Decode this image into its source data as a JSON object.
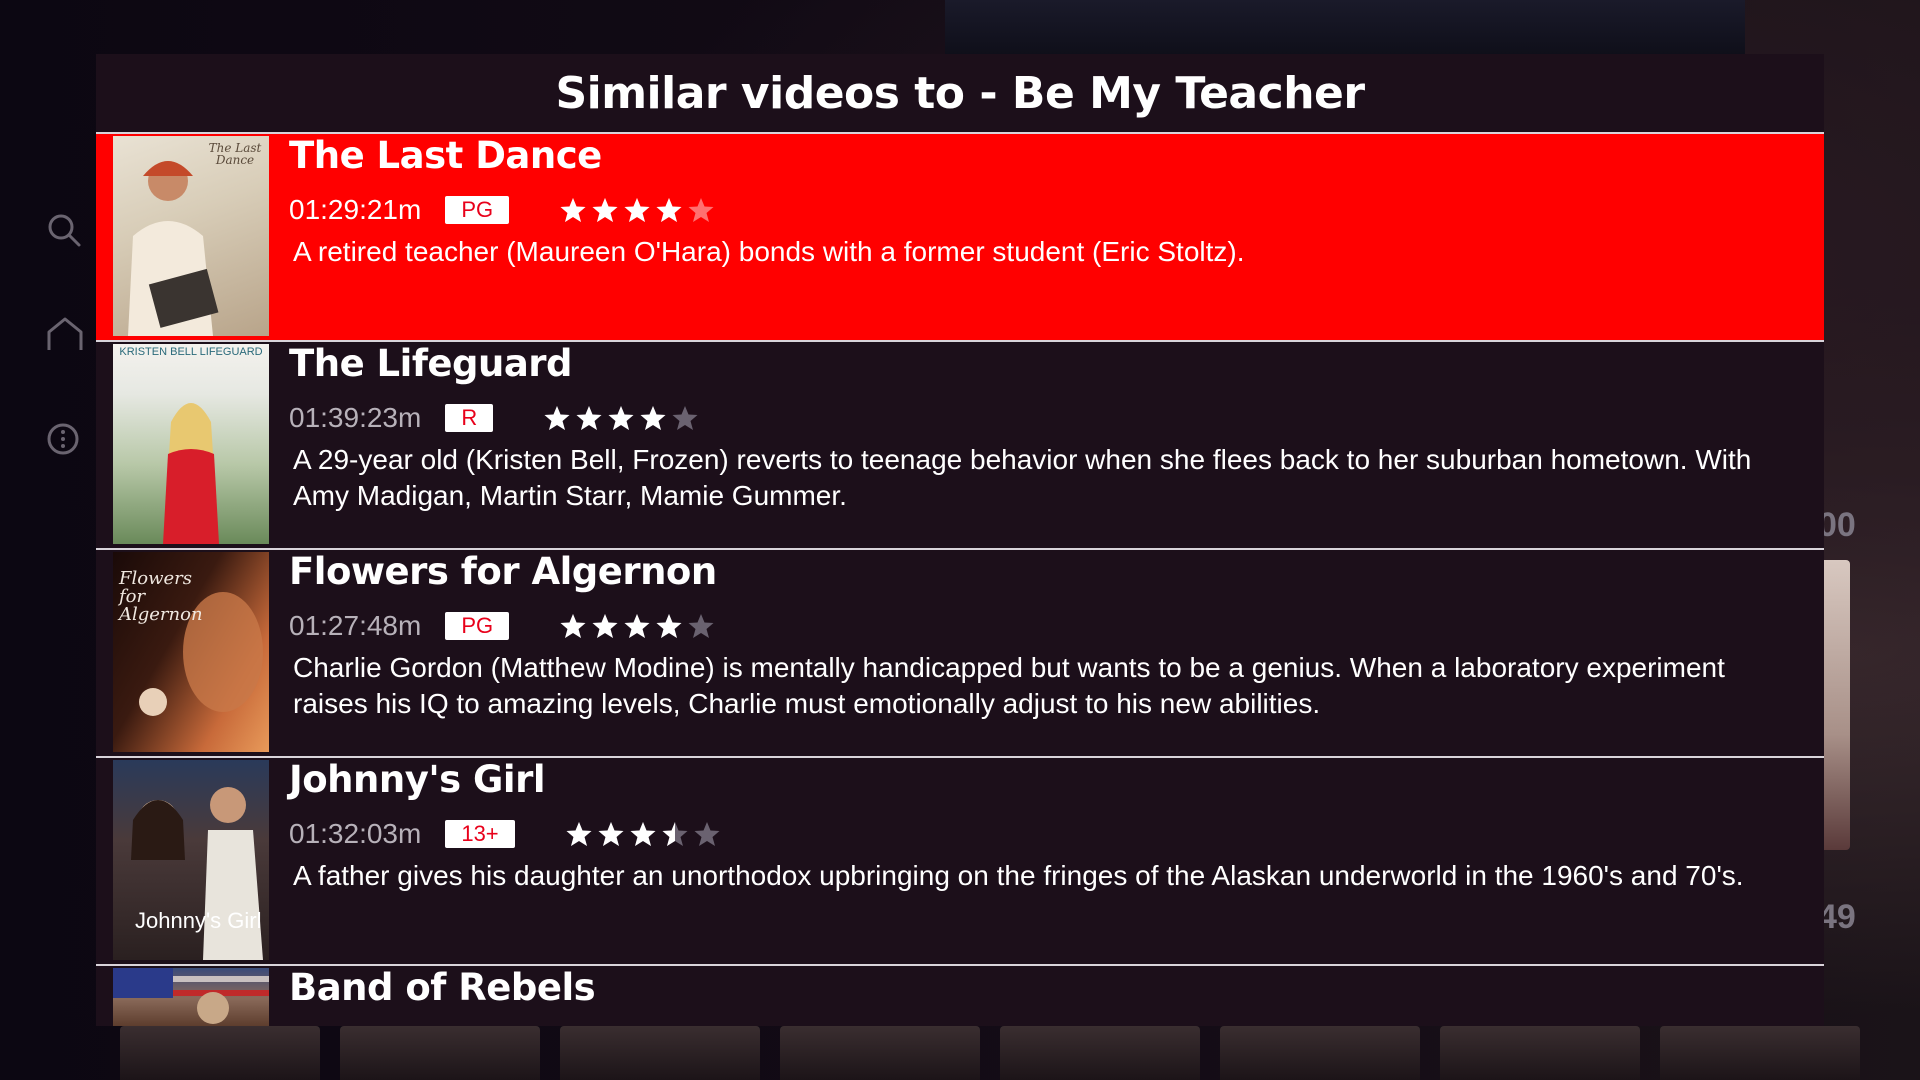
{
  "panel": {
    "title": "Similar videos to - Be My Teacher"
  },
  "background": {
    "right_text_1": "00",
    "right_text_2": "49"
  },
  "sidebar": {
    "icons": [
      "search-icon",
      "home-icon",
      "info-icon"
    ]
  },
  "videos": [
    {
      "title": "The Last Dance",
      "duration": "01:29:21m",
      "rating": "PG",
      "stars": 4,
      "description": "A retired teacher (Maureen O'Hara) bonds with a former student (Eric Stoltz).",
      "poster_text": "The Last Dance",
      "selected": true
    },
    {
      "title": "The Lifeguard",
      "duration": "01:39:23m",
      "rating": "R",
      "stars": 4,
      "description": "A 29-year old (Kristen Bell, Frozen) reverts to teenage behavior when she flees back to her suburban hometown. With Amy Madigan, Martin Starr, Mamie Gummer.",
      "poster_text": "KRISTEN BELL LIFEGUARD",
      "selected": false
    },
    {
      "title": "Flowers for Algernon",
      "duration": "01:27:48m",
      "rating": "PG",
      "stars": 4,
      "description": "Charlie Gordon (Matthew Modine) is mentally handicapped but wants to be a genius. When a laboratory experiment raises his IQ to amazing levels, Charlie must emotionally adjust to his new abilities.",
      "poster_text": "Flowers for Algernon",
      "selected": false
    },
    {
      "title": "Johnny's Girl",
      "duration": "01:32:03m",
      "rating": "13+",
      "stars": 3.5,
      "description": "A father gives his daughter an unorthodox upbringing on the fringes of the Alaskan underworld in the 1960's and 70's.",
      "poster_text": "Johnny's Girl",
      "selected": false
    },
    {
      "title": "Band of Rebels",
      "selected": false
    }
  ],
  "colors": {
    "accent": "#ff0000",
    "panel_bg": "#1c0f1a",
    "badge_text": "#e8001a"
  }
}
